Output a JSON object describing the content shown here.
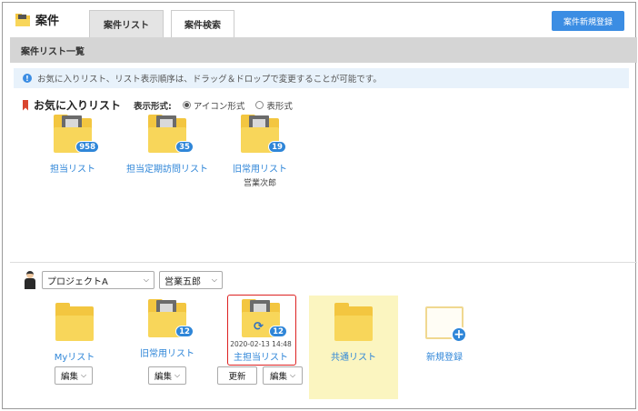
{
  "header": {
    "title": "案件",
    "tabs": [
      {
        "label": "案件リスト"
      },
      {
        "label": "案件検索"
      }
    ],
    "new_button": "案件新規登録"
  },
  "section": {
    "title": "案件リスト一覧"
  },
  "info": {
    "text": "お気に入りリスト、リスト表示順序は、ドラッグ＆ドロップで変更することが可能です。"
  },
  "favorites": {
    "title": "お気に入りリスト",
    "display_format_label": "表示形式:",
    "options": [
      {
        "label": "アイコン形式",
        "selected": true
      },
      {
        "label": "表形式",
        "selected": false
      }
    ],
    "items": [
      {
        "label": "担当リスト",
        "count": "958",
        "sub": ""
      },
      {
        "label": "担当定期訪問リスト",
        "count": "35",
        "sub": ""
      },
      {
        "label": "旧常用リスト",
        "count": "19",
        "sub": "営業次郎"
      }
    ]
  },
  "project": {
    "project_select": "プロジェクトA",
    "user_select": "営業五郎",
    "items": [
      {
        "label": "Myリスト",
        "edit": "編集"
      },
      {
        "label": "旧常用リスト",
        "count": "12",
        "edit": "編集"
      },
      {
        "label": "主担当リスト",
        "count": "12",
        "date": "2020-02-13 14:48",
        "update": "更新",
        "edit": "編集"
      },
      {
        "label": "共通リスト"
      },
      {
        "label": "新規登録"
      }
    ]
  },
  "colors": {
    "accent": "#2f86d8",
    "folder": "#f3c640",
    "highlight": "#fbf5c0",
    "selection": "#dd2222"
  }
}
